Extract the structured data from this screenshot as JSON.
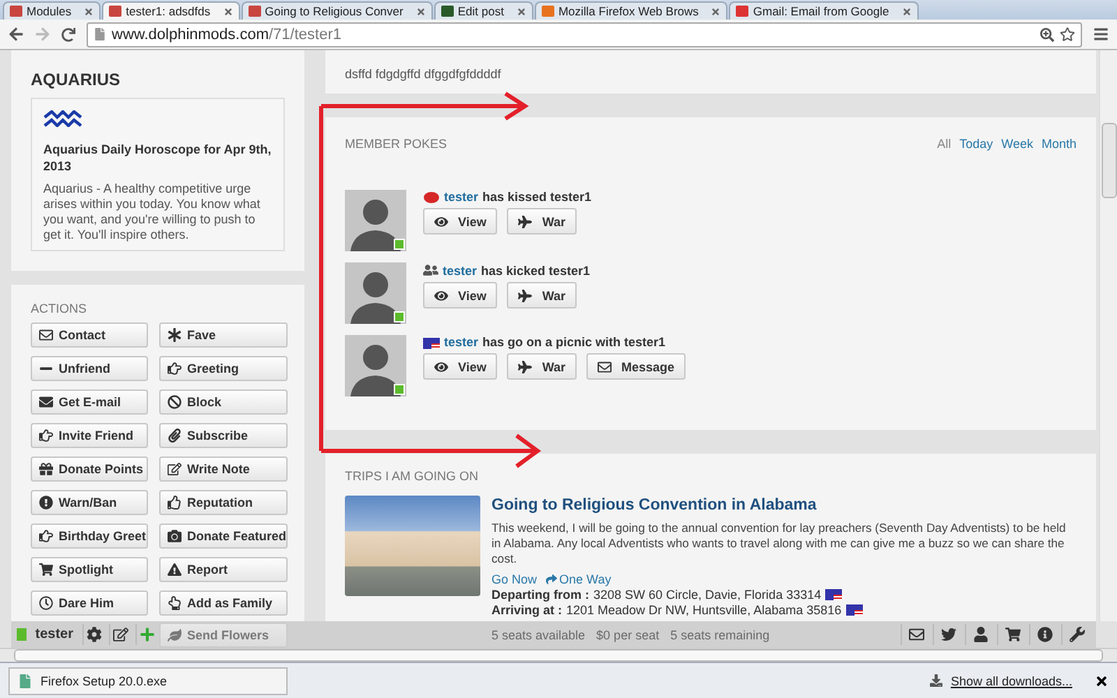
{
  "browser": {
    "tabs": [
      {
        "title": "Modules",
        "kind": "site",
        "selected": false
      },
      {
        "title": "tester1: adsdfds",
        "kind": "site",
        "selected": true
      },
      {
        "title": "Going to Religious Conver",
        "kind": "site",
        "selected": false
      },
      {
        "title": "Edit post",
        "kind": "edit",
        "selected": false
      },
      {
        "title": "Mozilla Firefox Web Brows",
        "kind": "firefox",
        "selected": false
      },
      {
        "title": "Gmail: Email from Google",
        "kind": "gmail",
        "selected": false
      }
    ],
    "address": {
      "host": "www.dolphinmods.com",
      "path": "/71/tester1"
    }
  },
  "horoscope": {
    "title": "AQUARIUS",
    "heading": "Aquarius Daily Horoscope for Apr 9th, 2013",
    "text": "Aquarius - A healthy competitive urge arises within you today. You know what you want, and you're willing to push to get it. You'll inspire others."
  },
  "actions": {
    "title": "ACTIONS",
    "buttons": [
      {
        "label": "Contact",
        "kind": "mail"
      },
      {
        "label": "Fave",
        "kind": "asterisk"
      },
      {
        "label": "Unfriend",
        "kind": "minus"
      },
      {
        "label": "Greeting",
        "kind": "hand"
      },
      {
        "label": "Get E-mail",
        "kind": "mailfill"
      },
      {
        "label": "Block",
        "kind": "ban"
      },
      {
        "label": "Invite Friend",
        "kind": "hand"
      },
      {
        "label": "Subscribe",
        "kind": "clip"
      },
      {
        "label": "Donate Points",
        "kind": "gift"
      },
      {
        "label": "Write Note",
        "kind": "note"
      },
      {
        "label": "Warn/Ban",
        "kind": "warn"
      },
      {
        "label": "Reputation",
        "kind": "thumb"
      },
      {
        "label": "Birthday Greet",
        "kind": "hand"
      },
      {
        "label": "Donate Featured",
        "kind": "camera"
      },
      {
        "label": "Spotlight",
        "kind": "cart"
      },
      {
        "label": "Report",
        "kind": "triangle"
      },
      {
        "label": "Dare Him",
        "kind": "clock"
      },
      {
        "label": "Add as Family",
        "kind": "pointer"
      },
      {
        "label": "Send Flowers",
        "kind": "leaf"
      }
    ]
  },
  "status_text": "dsffd fdgdgffd dfggdfgfddddf",
  "pokes": {
    "title": "MEMBER POKES",
    "filters": [
      {
        "label": "All",
        "selected": true
      },
      {
        "label": "Today",
        "selected": false
      },
      {
        "label": "Week",
        "selected": false
      },
      {
        "label": "Month",
        "selected": false
      }
    ],
    "items": [
      {
        "kind": "kiss",
        "actor": "tester",
        "action": "has kissed tester1",
        "online": true,
        "buttons": [
          {
            "label": "View",
            "kind": "eye"
          },
          {
            "label": "War",
            "kind": "plane"
          }
        ]
      },
      {
        "kind": "kick",
        "actor": "tester",
        "action": "has kicked tester1",
        "online": true,
        "buttons": [
          {
            "label": "View",
            "kind": "eye"
          },
          {
            "label": "War",
            "kind": "plane"
          }
        ]
      },
      {
        "kind": "flag",
        "actor": "tester",
        "action": "has go on a picnic with tester1",
        "online": true,
        "buttons": [
          {
            "label": "View",
            "kind": "eye"
          },
          {
            "label": "War",
            "kind": "plane"
          },
          {
            "label": "Message",
            "kind": "mail"
          }
        ]
      }
    ]
  },
  "trips": {
    "title": "TRIPS I AM GOING ON",
    "trip": {
      "title": "Going to Religious Convention in Alabama",
      "description": "This weekend, I will be going to the annual convention for lay preachers (Seventh Day Adventists) to be held in Alabama. Any local Adventists who wants to travel along with me can give me a buzz so we can share the cost.",
      "links": [
        "Go Now",
        "One Way"
      ],
      "departing_label": "Departing from :",
      "departing": "3208 SW 60 Circle, Davie, Florida 33314",
      "arriving_label": "Arriving at :",
      "arriving": "1201 Meadow Dr NW, Huntsville, Alabama 35816",
      "stats": [
        "5 seats available",
        "$0 per seat",
        "5 seats remaining"
      ]
    }
  },
  "user_bar": {
    "user": "tester",
    "online": true
  },
  "downloads": {
    "file": "Firefox Setup 20.0.exe",
    "show_all": "Show all downloads..."
  }
}
